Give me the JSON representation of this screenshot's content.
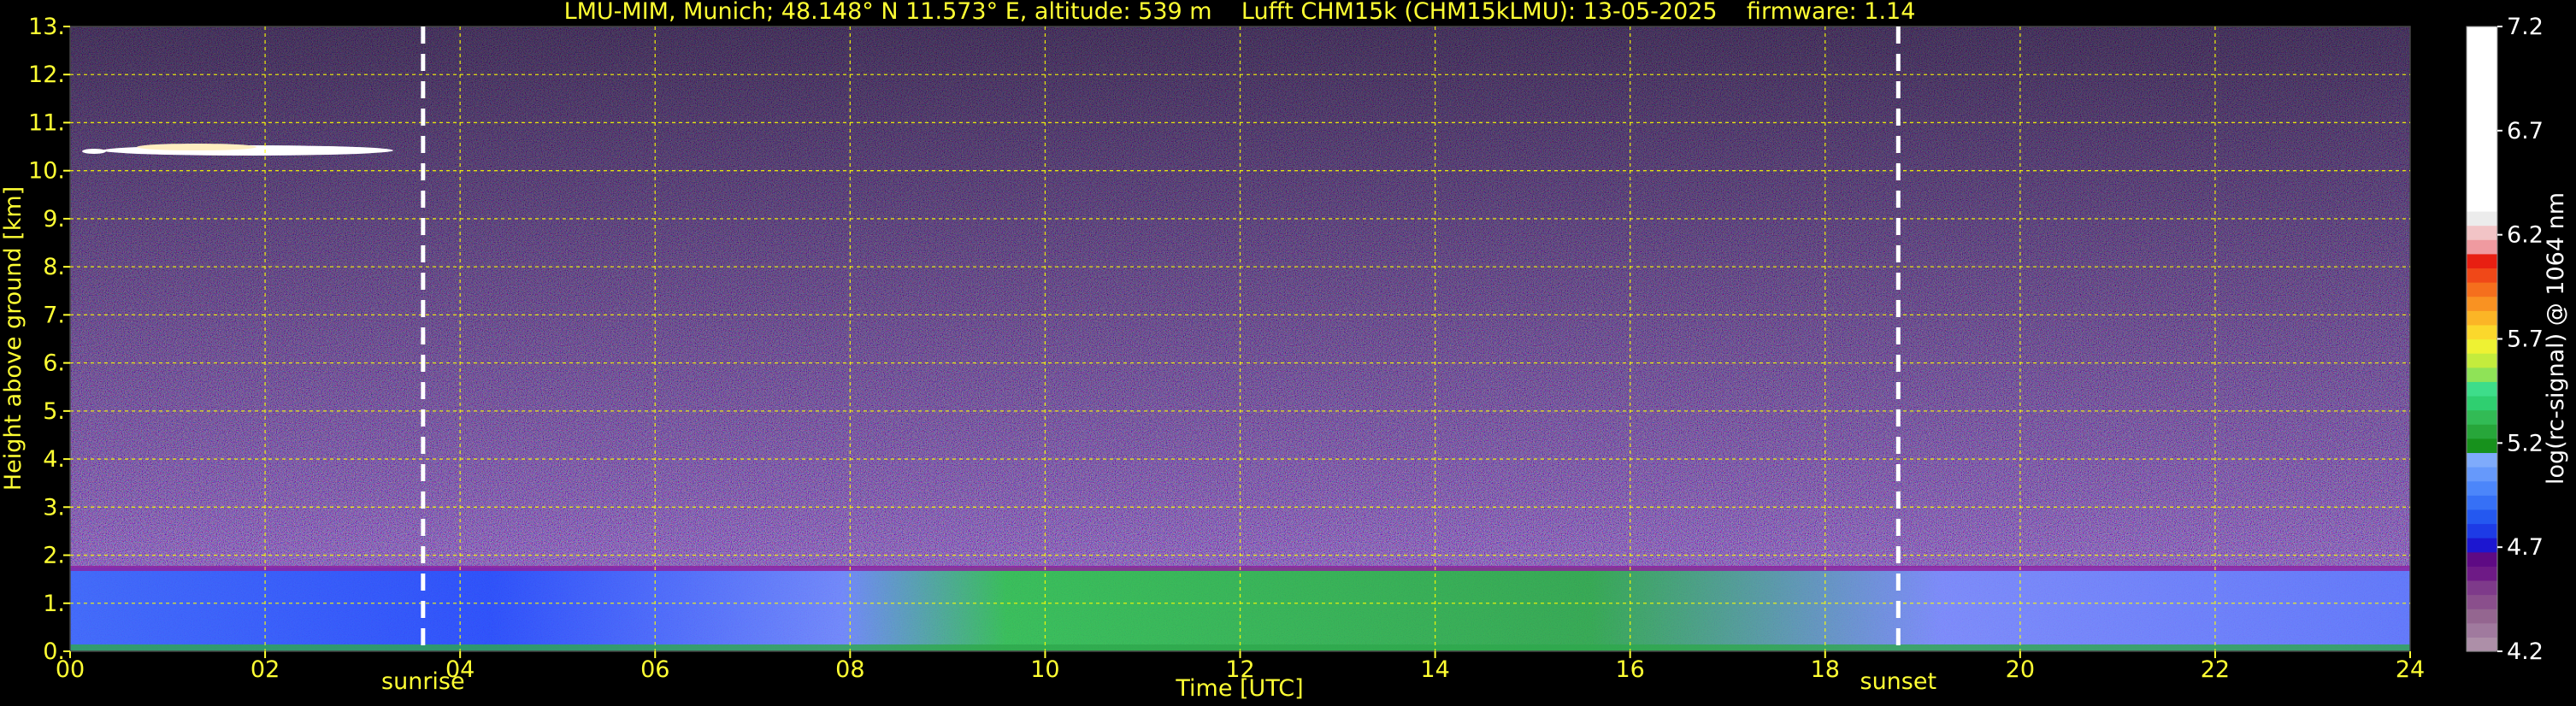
{
  "chart_data": {
    "type": "heatmap",
    "title": "LMU-MIM, Munich; 48.148° N 11.573° E, altitude: 539 m    Lufft CHM15k (CHM15kLMU): 13-05-2025    firmware: 1.14",
    "xlabel": "Time [UTC]",
    "ylabel": "Height above ground [km]",
    "xlim": [
      0,
      24
    ],
    "ylim": [
      0,
      13
    ],
    "x_ticks": [
      "00",
      "02",
      "04",
      "06",
      "08",
      "10",
      "12",
      "14",
      "16",
      "18",
      "20",
      "22",
      "24"
    ],
    "y_ticks": [
      "0.",
      "1.",
      "2.",
      "3.",
      "4.",
      "5.",
      "6.",
      "7.",
      "8.",
      "9.",
      "10.",
      "11.",
      "12.",
      "13."
    ],
    "grid": true,
    "events": [
      {
        "label": "sunrise",
        "time": 3.62
      },
      {
        "label": "sunset",
        "time": 18.75
      }
    ],
    "colorbar": {
      "label": "log(rc-signal) @ 1064 nm",
      "range": [
        4.2,
        7.2
      ],
      "ticks": [
        "4.2",
        "4.7",
        "5.2",
        "5.7",
        "6.2",
        "6.7",
        "7.2"
      ]
    },
    "features": [
      {
        "name": "cirrus cloud",
        "time": [
          0.1,
          3.4
        ],
        "height_km": [
          10.3,
          10.5
        ]
      },
      {
        "name": "boundary layer top",
        "time": [
          0,
          24
        ],
        "height_km": 1.7
      }
    ]
  },
  "colors": {
    "axis_text": "#ffff33",
    "grid": "#ffff00",
    "background": "#000000",
    "event_line": "#ffffff"
  }
}
